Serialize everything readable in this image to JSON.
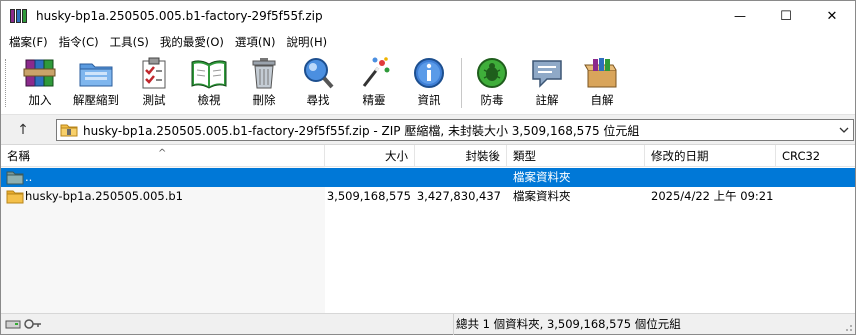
{
  "window": {
    "title": "husky-bp1a.250505.005.b1-factory-29f5f55f.zip",
    "minimize_symbol": "—",
    "maximize_symbol": "☐",
    "close_symbol": "✕"
  },
  "menu": [
    {
      "label": "檔案(F)"
    },
    {
      "label": "指令(C)"
    },
    {
      "label": "工具(S)"
    },
    {
      "label": "我的最愛(O)"
    },
    {
      "label": "選項(N)"
    },
    {
      "label": "說明(H)"
    }
  ],
  "toolbar": [
    {
      "label": "加入",
      "icon": "add-icon"
    },
    {
      "label": "解壓縮到",
      "icon": "extract-to-icon"
    },
    {
      "label": "測試",
      "icon": "test-icon"
    },
    {
      "label": "檢視",
      "icon": "view-icon"
    },
    {
      "label": "刪除",
      "icon": "delete-icon"
    },
    {
      "label": "尋找",
      "icon": "find-icon"
    },
    {
      "label": "精靈",
      "icon": "wizard-icon"
    },
    {
      "label": "資訊",
      "icon": "info-icon"
    },
    {
      "label": "防毒",
      "icon": "virus-scan-icon"
    },
    {
      "label": "註解",
      "icon": "comment-icon"
    },
    {
      "label": "自解",
      "icon": "sfx-icon"
    }
  ],
  "address": {
    "up_symbol": "↑",
    "path": "husky-bp1a.250505.005.b1-factory-29f5f55f.zip - ZIP 壓縮檔, 未封裝大小 3,509,168,575 位元組"
  },
  "columns": {
    "name": "名稱",
    "size": "大小",
    "packed": "封裝後",
    "type": "類型",
    "modified": "修改的日期",
    "crc": "CRC32",
    "sort_indicator": "^"
  },
  "rows": [
    {
      "name": "..",
      "size": "",
      "packed": "",
      "type": "檔案資料夾",
      "modified": "",
      "crc": "",
      "selected": true
    },
    {
      "name": "husky-bp1a.250505.005.b1",
      "size": "3,509,168,575",
      "packed": "3,427,830,437",
      "type": "檔案資料夾",
      "modified": "2025/4/22 上午 09:21",
      "crc": "",
      "selected": false
    }
  ],
  "status": {
    "text": "總共 1 個資料夾, 3,509,168,575 個位元組"
  },
  "colors": {
    "selection": "#0078d7",
    "folder": "#f4c04a"
  }
}
